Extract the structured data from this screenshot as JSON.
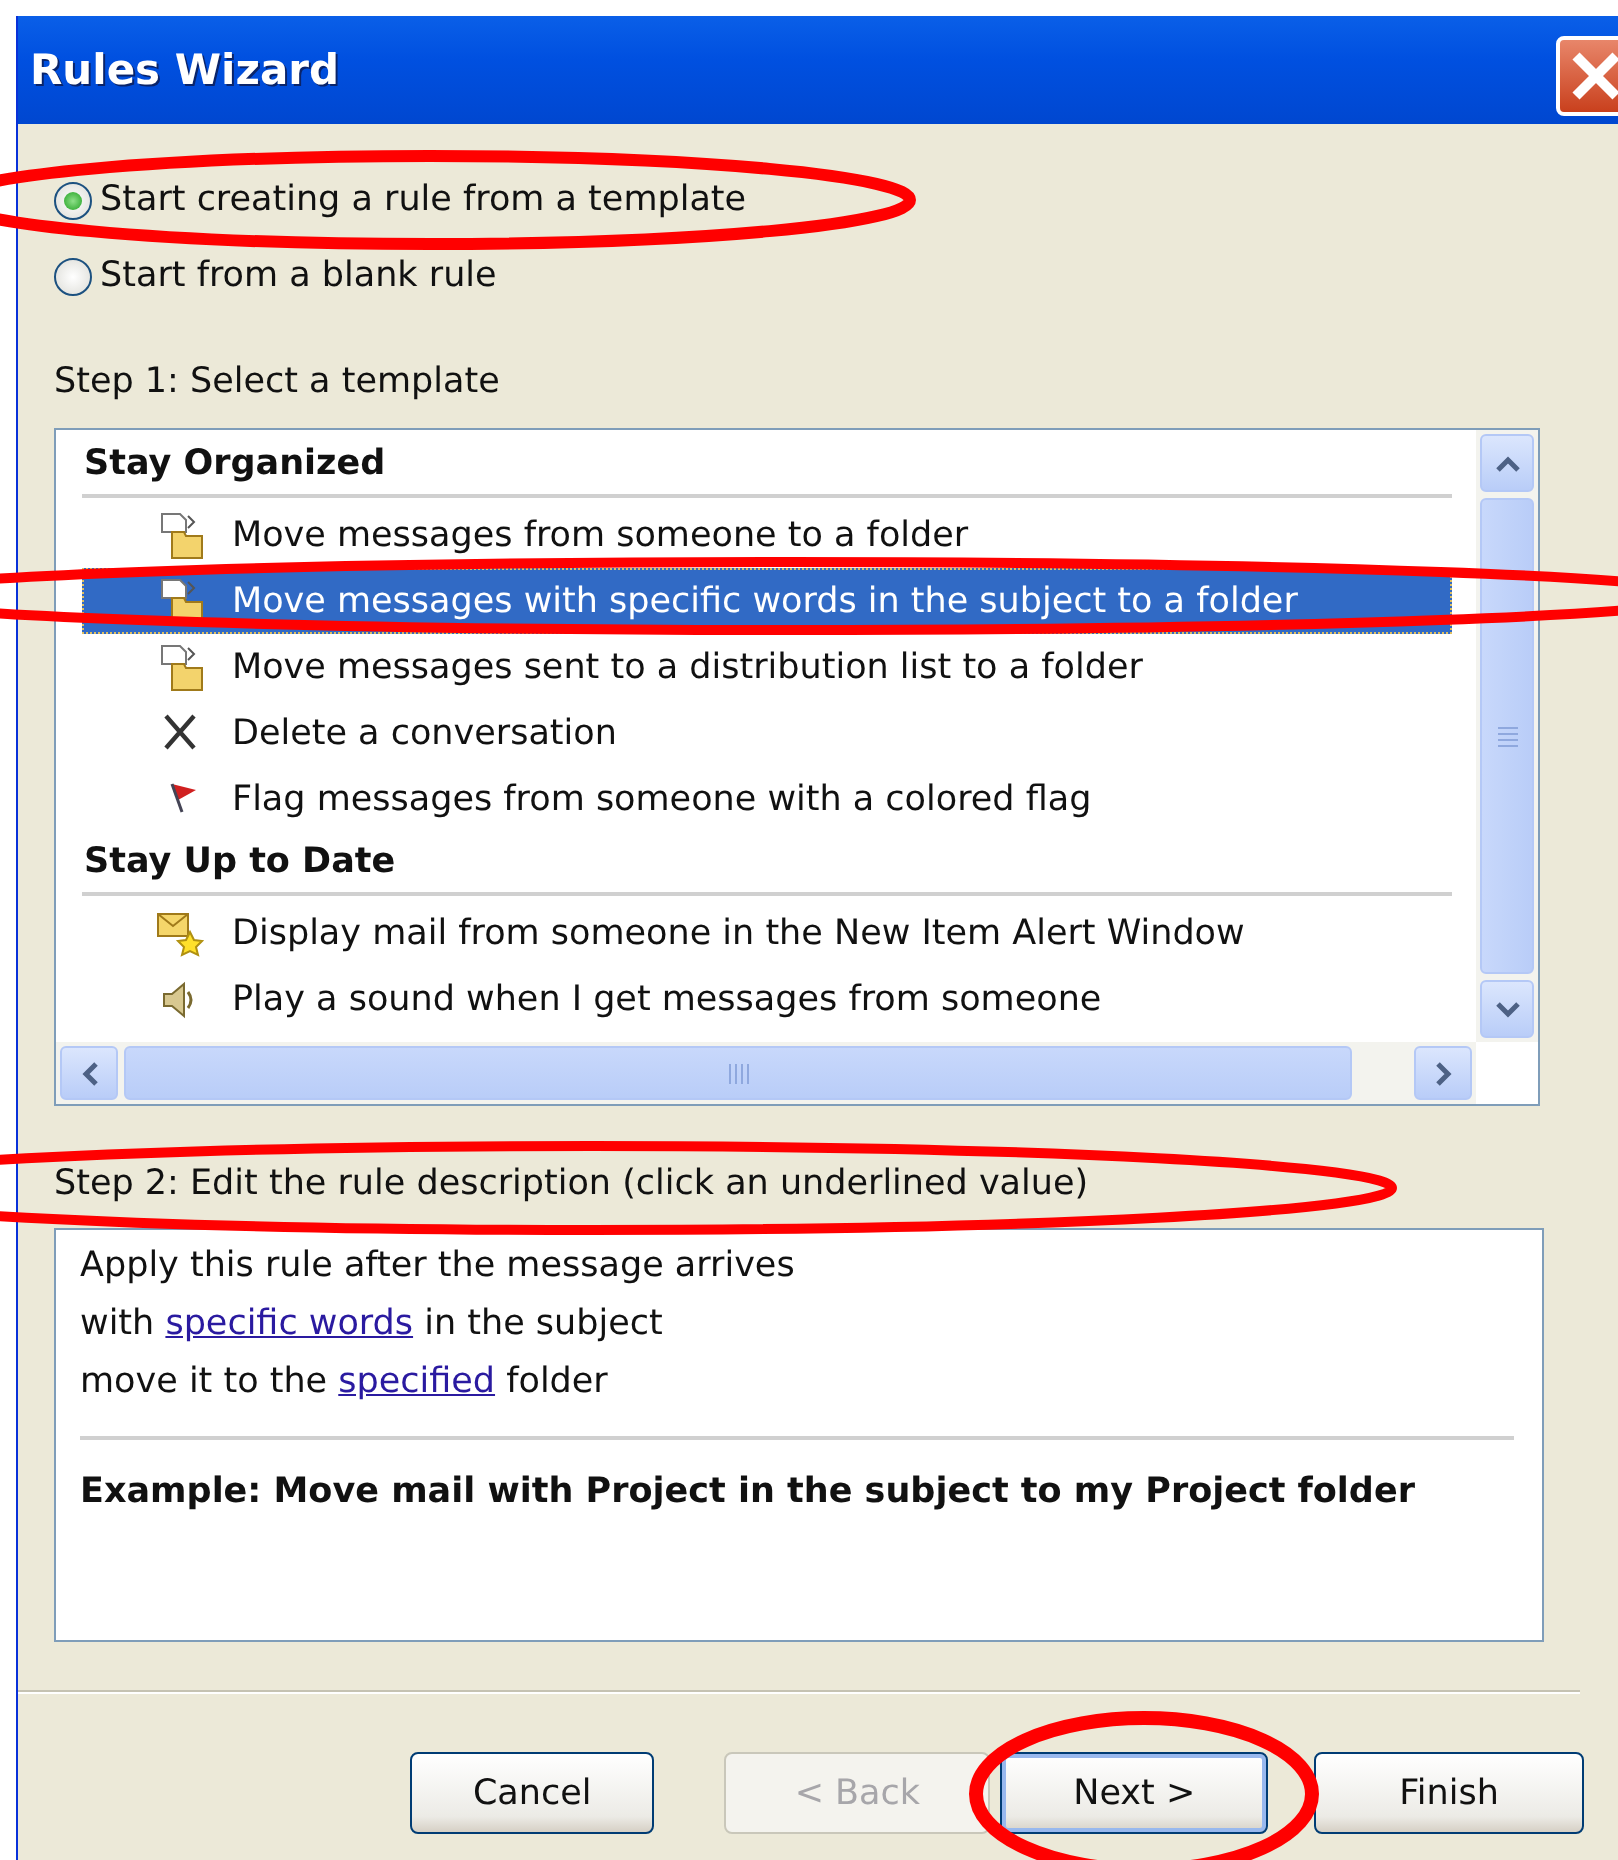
{
  "window": {
    "title": "Rules Wizard"
  },
  "options": [
    {
      "label": "Start creating a rule from a template",
      "selected": true
    },
    {
      "label": "Start from a blank rule",
      "selected": false
    }
  ],
  "step1": {
    "label": "Step 1: Select a template"
  },
  "templates": [
    {
      "title": "Stay Organized",
      "items": [
        {
          "label": "Move messages from someone to a folder",
          "kind": "move",
          "selected": false
        },
        {
          "label": "Move messages with specific words in the subject to a folder",
          "kind": "move",
          "selected": true
        },
        {
          "label": "Move messages sent to a distribution list to a folder",
          "kind": "move",
          "selected": false
        },
        {
          "label": "Delete a conversation",
          "kind": "delete",
          "selected": false
        },
        {
          "label": "Flag messages from someone with a colored flag",
          "kind": "flag",
          "selected": false
        }
      ]
    },
    {
      "title": "Stay Up to Date",
      "items": [
        {
          "label": "Display mail from someone in the New Item Alert Window",
          "kind": "alert",
          "selected": false
        },
        {
          "label": "Play a sound when I get messages from someone",
          "kind": "sound",
          "selected": false
        }
      ]
    }
  ],
  "step2": {
    "label": "Step 2: Edit the rule description (click an underlined value)"
  },
  "description": {
    "lines": [
      [
        {
          "kind": "text",
          "text": "Apply this rule after the message arrives"
        }
      ],
      [
        {
          "kind": "text",
          "text": "with "
        },
        {
          "kind": "link",
          "text": "specific words"
        },
        {
          "kind": "text",
          "text": " in the subject"
        }
      ],
      [
        {
          "kind": "text",
          "text": "move it to the "
        },
        {
          "kind": "link",
          "text": "specified"
        },
        {
          "kind": "text",
          "text": " folder"
        }
      ]
    ],
    "example": "Example: Move mail with Project in the subject to my Project folder"
  },
  "buttons": [
    {
      "label": "Cancel",
      "disabled": false,
      "default": false
    },
    {
      "label": "< Back",
      "disabled": true,
      "default": false
    },
    {
      "label": "Next >",
      "disabled": false,
      "default": true
    },
    {
      "label": "Finish",
      "disabled": false,
      "default": false
    }
  ]
}
